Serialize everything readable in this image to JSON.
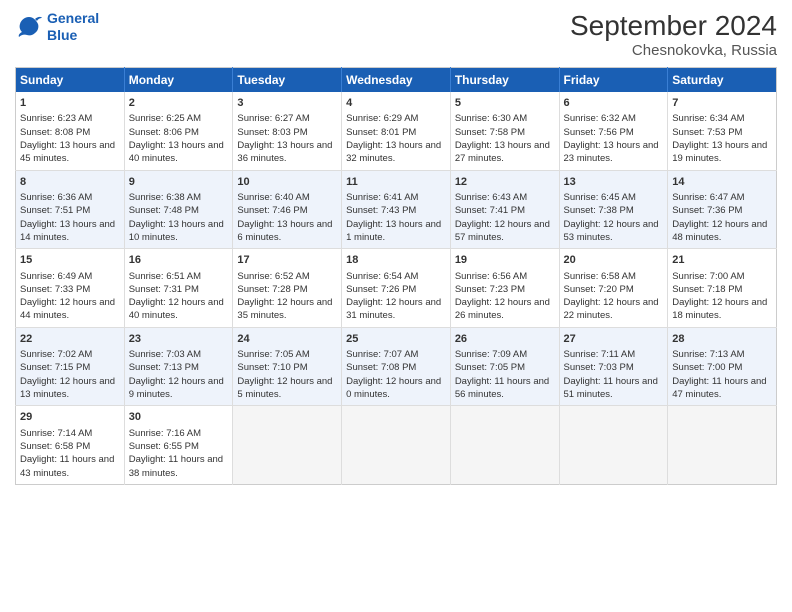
{
  "header": {
    "logo_line1": "General",
    "logo_line2": "Blue",
    "title": "September 2024",
    "subtitle": "Chesnokovka, Russia"
  },
  "weekdays": [
    "Sunday",
    "Monday",
    "Tuesday",
    "Wednesday",
    "Thursday",
    "Friday",
    "Saturday"
  ],
  "weeks": [
    [
      {
        "day": "1",
        "sunrise": "6:23 AM",
        "sunset": "8:08 PM",
        "daylight": "13 hours and 45 minutes."
      },
      {
        "day": "2",
        "sunrise": "6:25 AM",
        "sunset": "8:06 PM",
        "daylight": "13 hours and 40 minutes."
      },
      {
        "day": "3",
        "sunrise": "6:27 AM",
        "sunset": "8:03 PM",
        "daylight": "13 hours and 36 minutes."
      },
      {
        "day": "4",
        "sunrise": "6:29 AM",
        "sunset": "8:01 PM",
        "daylight": "13 hours and 32 minutes."
      },
      {
        "day": "5",
        "sunrise": "6:30 AM",
        "sunset": "7:58 PM",
        "daylight": "13 hours and 27 minutes."
      },
      {
        "day": "6",
        "sunrise": "6:32 AM",
        "sunset": "7:56 PM",
        "daylight": "13 hours and 23 minutes."
      },
      {
        "day": "7",
        "sunrise": "6:34 AM",
        "sunset": "7:53 PM",
        "daylight": "13 hours and 19 minutes."
      }
    ],
    [
      {
        "day": "8",
        "sunrise": "6:36 AM",
        "sunset": "7:51 PM",
        "daylight": "13 hours and 14 minutes."
      },
      {
        "day": "9",
        "sunrise": "6:38 AM",
        "sunset": "7:48 PM",
        "daylight": "13 hours and 10 minutes."
      },
      {
        "day": "10",
        "sunrise": "6:40 AM",
        "sunset": "7:46 PM",
        "daylight": "13 hours and 6 minutes."
      },
      {
        "day": "11",
        "sunrise": "6:41 AM",
        "sunset": "7:43 PM",
        "daylight": "13 hours and 1 minute."
      },
      {
        "day": "12",
        "sunrise": "6:43 AM",
        "sunset": "7:41 PM",
        "daylight": "12 hours and 57 minutes."
      },
      {
        "day": "13",
        "sunrise": "6:45 AM",
        "sunset": "7:38 PM",
        "daylight": "12 hours and 53 minutes."
      },
      {
        "day": "14",
        "sunrise": "6:47 AM",
        "sunset": "7:36 PM",
        "daylight": "12 hours and 48 minutes."
      }
    ],
    [
      {
        "day": "15",
        "sunrise": "6:49 AM",
        "sunset": "7:33 PM",
        "daylight": "12 hours and 44 minutes."
      },
      {
        "day": "16",
        "sunrise": "6:51 AM",
        "sunset": "7:31 PM",
        "daylight": "12 hours and 40 minutes."
      },
      {
        "day": "17",
        "sunrise": "6:52 AM",
        "sunset": "7:28 PM",
        "daylight": "12 hours and 35 minutes."
      },
      {
        "day": "18",
        "sunrise": "6:54 AM",
        "sunset": "7:26 PM",
        "daylight": "12 hours and 31 minutes."
      },
      {
        "day": "19",
        "sunrise": "6:56 AM",
        "sunset": "7:23 PM",
        "daylight": "12 hours and 26 minutes."
      },
      {
        "day": "20",
        "sunrise": "6:58 AM",
        "sunset": "7:20 PM",
        "daylight": "12 hours and 22 minutes."
      },
      {
        "day": "21",
        "sunrise": "7:00 AM",
        "sunset": "7:18 PM",
        "daylight": "12 hours and 18 minutes."
      }
    ],
    [
      {
        "day": "22",
        "sunrise": "7:02 AM",
        "sunset": "7:15 PM",
        "daylight": "12 hours and 13 minutes."
      },
      {
        "day": "23",
        "sunrise": "7:03 AM",
        "sunset": "7:13 PM",
        "daylight": "12 hours and 9 minutes."
      },
      {
        "day": "24",
        "sunrise": "7:05 AM",
        "sunset": "7:10 PM",
        "daylight": "12 hours and 5 minutes."
      },
      {
        "day": "25",
        "sunrise": "7:07 AM",
        "sunset": "7:08 PM",
        "daylight": "12 hours and 0 minutes."
      },
      {
        "day": "26",
        "sunrise": "7:09 AM",
        "sunset": "7:05 PM",
        "daylight": "11 hours and 56 minutes."
      },
      {
        "day": "27",
        "sunrise": "7:11 AM",
        "sunset": "7:03 PM",
        "daylight": "11 hours and 51 minutes."
      },
      {
        "day": "28",
        "sunrise": "7:13 AM",
        "sunset": "7:00 PM",
        "daylight": "11 hours and 47 minutes."
      }
    ],
    [
      {
        "day": "29",
        "sunrise": "7:14 AM",
        "sunset": "6:58 PM",
        "daylight": "11 hours and 43 minutes."
      },
      {
        "day": "30",
        "sunrise": "7:16 AM",
        "sunset": "6:55 PM",
        "daylight": "11 hours and 38 minutes."
      },
      null,
      null,
      null,
      null,
      null
    ]
  ]
}
